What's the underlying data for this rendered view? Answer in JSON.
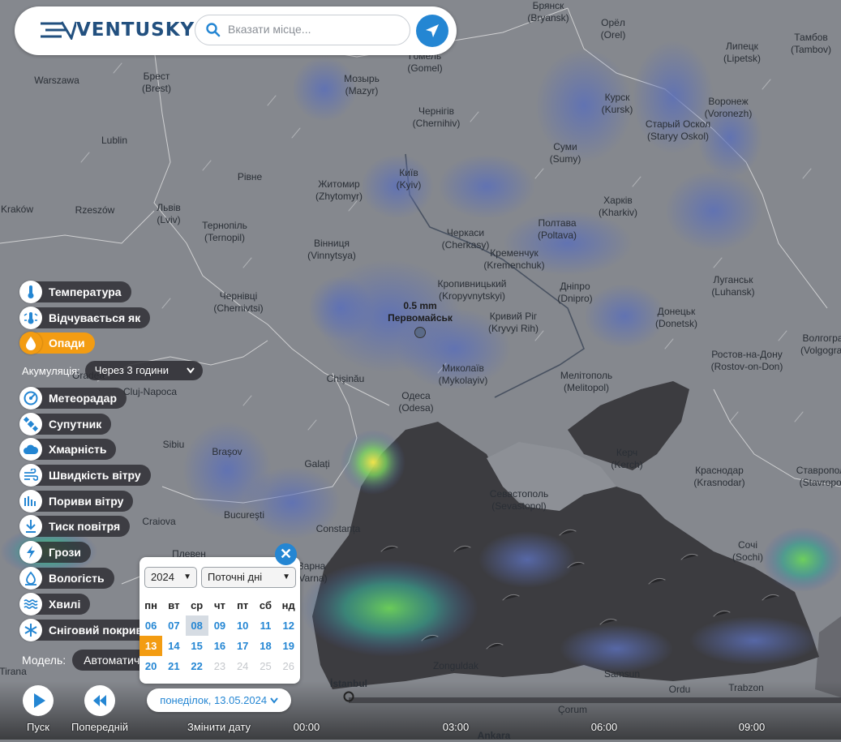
{
  "app": {
    "name": "VENTUSKY"
  },
  "search": {
    "placeholder": "Вказати місце..."
  },
  "layers": [
    {
      "label": "Температура",
      "icon": "thermometer-icon",
      "active": false
    },
    {
      "label": "Відчувається як",
      "icon": "feels-like-icon",
      "active": false
    },
    {
      "label": "Опади",
      "icon": "drop-icon",
      "active": true
    },
    {
      "label": "Метеорадар",
      "icon": "radar-icon",
      "active": false
    },
    {
      "label": "Супутник",
      "icon": "satellite-icon",
      "active": false
    },
    {
      "label": "Хмарність",
      "icon": "cloud-icon",
      "active": false
    },
    {
      "label": "Швидкість вітру",
      "icon": "wind-icon",
      "active": false
    },
    {
      "label": "Пориви вітру",
      "icon": "gust-icon",
      "active": false
    },
    {
      "label": "Тиск повітря",
      "icon": "pressure-icon",
      "active": false
    },
    {
      "label": "Грози",
      "icon": "lightning-icon",
      "active": false
    },
    {
      "label": "Вологість",
      "icon": "humidity-icon",
      "active": false
    },
    {
      "label": "Хвилі",
      "icon": "waves-icon",
      "active": false
    },
    {
      "label": "Сніговий покрив",
      "icon": "snowflake-icon",
      "active": false
    }
  ],
  "accumulation": {
    "label": "Акумуляція:",
    "value": "Через 3 години"
  },
  "model": {
    "label": "Модель:",
    "value": "Автоматична"
  },
  "calendar": {
    "year": "2024",
    "range": "Поточні дні",
    "weekdays": [
      "пн",
      "вт",
      "ср",
      "чт",
      "пт",
      "сб",
      "нд"
    ],
    "weeks": [
      [
        "06",
        "07",
        "08",
        "09",
        "10",
        "11",
        "12"
      ],
      [
        "13",
        "14",
        "15",
        "16",
        "17",
        "18",
        "19"
      ],
      [
        "20",
        "21",
        "22",
        "23",
        "24",
        "25",
        "26"
      ]
    ],
    "today": "13",
    "highlight": "08",
    "disabled": [
      "23",
      "24",
      "25",
      "26"
    ]
  },
  "controls": {
    "play": "Пуск",
    "previous": "Попередній",
    "change_date": "Змінити дату",
    "date": "понеділок, 13.05.2024"
  },
  "timeline": {
    "ticks": [
      "00:00",
      "03:00",
      "06:00",
      "09:00"
    ]
  },
  "marker": {
    "value": "0.5 mm",
    "city": "Первомайськ"
  },
  "cities": [
    {
      "name": "Брянск",
      "sub": "(Bryansk)"
    },
    {
      "name": "Орёл",
      "sub": "(Orel)"
    },
    {
      "name": "Липецк",
      "sub": "(Lipetsk)"
    },
    {
      "name": "Тамбов",
      "sub": "(Tambov)"
    },
    {
      "name": "Гомель",
      "sub": "(Gomel)"
    },
    {
      "name": "Warszawa",
      "sub": ""
    },
    {
      "name": "Брест",
      "sub": "(Brest)"
    },
    {
      "name": "Мозырь",
      "sub": "(Mazyr)"
    },
    {
      "name": "Курск",
      "sub": "(Kursk)"
    },
    {
      "name": "Воронеж",
      "sub": "(Voronezh)"
    },
    {
      "name": "Чернігів",
      "sub": "(Chernihiv)"
    },
    {
      "name": "Старый Оскол",
      "sub": "(Staryy Oskol)"
    },
    {
      "name": "Lublin",
      "sub": ""
    },
    {
      "name": "Суми",
      "sub": "(Sumy)"
    },
    {
      "name": "Київ",
      "sub": "(Kyiv)"
    },
    {
      "name": "Рівне",
      "sub": ""
    },
    {
      "name": "Житомир",
      "sub": "(Zhytomyr)"
    },
    {
      "name": "Львів",
      "sub": "(Lviv)"
    },
    {
      "name": "Kraków",
      "sub": ""
    },
    {
      "name": "Rzeszów",
      "sub": ""
    },
    {
      "name": "Харків",
      "sub": "(Kharkiv)"
    },
    {
      "name": "Тернопіль",
      "sub": "(Ternopil)"
    },
    {
      "name": "Черкаси",
      "sub": "(Cherkasy)"
    },
    {
      "name": "Полтава",
      "sub": "(Poltava)"
    },
    {
      "name": "Вінниця",
      "sub": "(Vinnytsya)"
    },
    {
      "name": "Кременчук",
      "sub": "(Kremenchuk)"
    },
    {
      "name": "Кропивницький",
      "sub": "(Kropyvnytskyi)"
    },
    {
      "name": "Дніпро",
      "sub": "(Dnipro)"
    },
    {
      "name": "Луганськ",
      "sub": "(Luhansk)"
    },
    {
      "name": "Чернівці",
      "sub": "(Chernivtsi)"
    },
    {
      "name": "Кривий Ріг",
      "sub": "(Kryvyi Rih)"
    },
    {
      "name": "Донецьк",
      "sub": "(Donetsk)"
    },
    {
      "name": "Волгоград",
      "sub": "(Volgograd)"
    },
    {
      "name": "Ростов-на-Дону",
      "sub": "(Rostov-on-Don)"
    },
    {
      "name": "Chişinău",
      "sub": ""
    },
    {
      "name": "Миколаїв",
      "sub": "(Mykolayiv)"
    },
    {
      "name": "Мелітополь",
      "sub": "(Melitopol)"
    },
    {
      "name": "Oradea",
      "sub": ""
    },
    {
      "name": "Cluj-Napoca",
      "sub": ""
    },
    {
      "name": "Одеса",
      "sub": "(Odesa)"
    },
    {
      "name": "Sibiu",
      "sub": ""
    },
    {
      "name": "Braşov",
      "sub": ""
    },
    {
      "name": "Керч",
      "sub": "(Kerch)"
    },
    {
      "name": "Galați",
      "sub": ""
    },
    {
      "name": "Краснодар",
      "sub": "(Krasnodar)"
    },
    {
      "name": "Ставрополь",
      "sub": "(Stavropol)"
    },
    {
      "name": "Севастополь",
      "sub": "(Sevastopol)"
    },
    {
      "name": "Craiova",
      "sub": ""
    },
    {
      "name": "Bucureşti",
      "sub": ""
    },
    {
      "name": "Constanța",
      "sub": ""
    },
    {
      "name": "Плевен",
      "sub": ""
    },
    {
      "name": "Варна",
      "sub": "(Varna)"
    },
    {
      "name": "Сочі",
      "sub": "(Sochi)"
    },
    {
      "name": "Zonguldak",
      "sub": ""
    },
    {
      "name": "Samsun",
      "sub": ""
    },
    {
      "name": "Ordu",
      "sub": ""
    },
    {
      "name": "Trabzon",
      "sub": ""
    },
    {
      "name": "İstanbul",
      "sub": ""
    },
    {
      "name": "Çorum",
      "sub": ""
    },
    {
      "name": "Ankara",
      "sub": ""
    },
    {
      "name": "Tirana",
      "sub": ""
    }
  ],
  "colors": {
    "accent": "#2486d3",
    "active": "#f39c12",
    "sea": "#3c3c40",
    "land": "#85888e"
  }
}
